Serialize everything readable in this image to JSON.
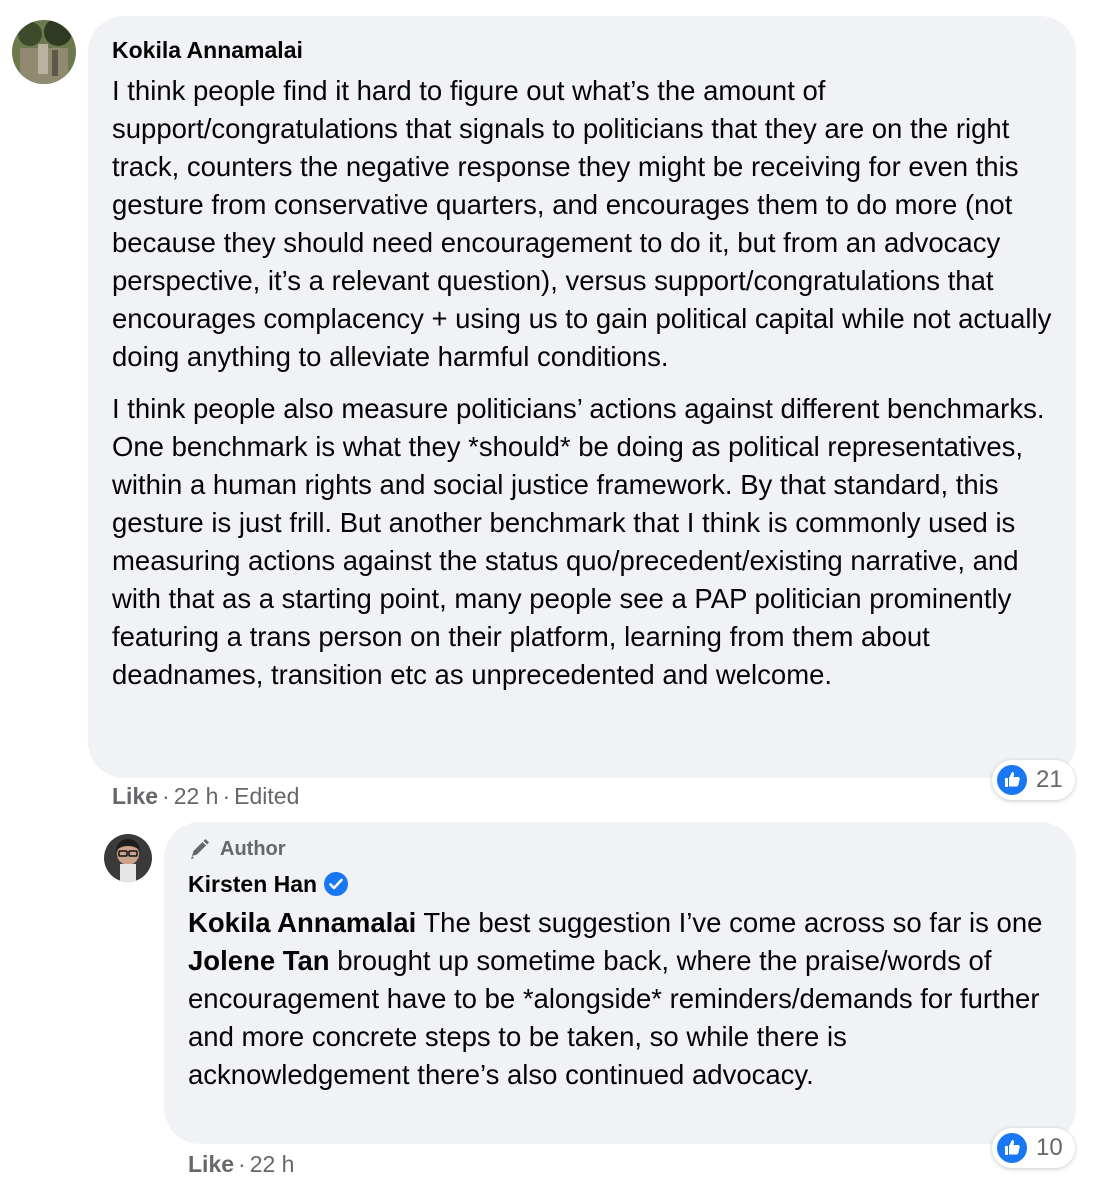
{
  "comments": [
    {
      "author": "Kokila Annamalai",
      "paragraphs": [
        "I think people find it hard to figure out what’s the amount of support/congratulations that signals to politicians that they are on the right track, counters the negative response they might be receiving for even this gesture from conservative quarters, and encourages them to do more (not because they should need encouragement to do it, but from an advocacy perspective, it’s a relevant question), versus support/congratulations that encourages complacency + using us to gain political capital while not actually doing anything to alleviate harmful conditions.",
        "I think people also measure politicians’ actions against different benchmarks. One benchmark is what they *should* be doing as political representatives, within a human rights and social justice framework. By that standard, this gesture is just frill. But another benchmark that I think is commonly used is measuring actions against the status quo/precedent/existing narrative, and with that as a starting point, many people see a PAP politician prominently featuring a trans person on their platform, learning from them about deadnames, transition etc as unprecedented and welcome."
      ],
      "like_label": "Like",
      "time": "22 h",
      "edited": "Edited",
      "reactions": "21"
    }
  ],
  "reply": {
    "badge": "Author",
    "author": "Kirsten Han",
    "mention_1": "Kokila Annamalai",
    "text_1": " The best suggestion I’ve come across so far is one ",
    "mention_2": "Jolene Tan",
    "text_2": " brought up sometime back, where the praise/words of encouragement have to be *alongside* reminders/demands for further and more concrete steps to be taken, so while there is acknowledgement there’s also continued advocacy.",
    "like_label": "Like",
    "time": "22 h",
    "reactions": "10"
  },
  "colors": {
    "bubble": "#f0f2f5",
    "meta_text": "#65676b",
    "like_blue": "#1877f2"
  }
}
